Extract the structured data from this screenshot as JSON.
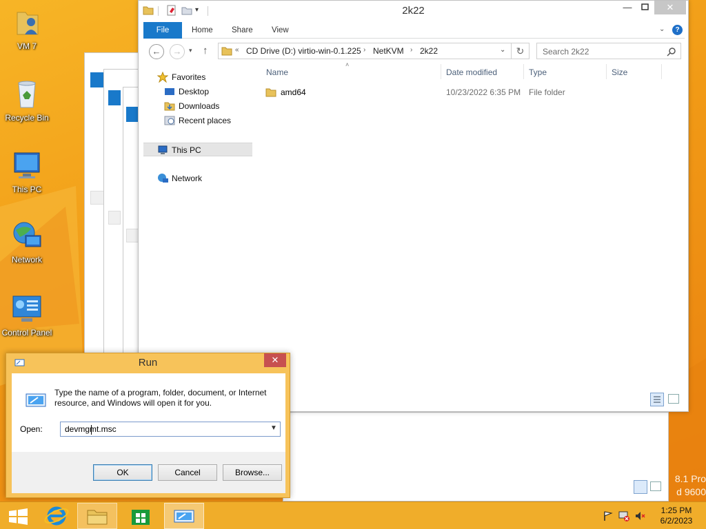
{
  "desktop": {
    "icons": [
      {
        "label": "VM 7",
        "icon": "user-folder-icon"
      },
      {
        "label": "Recycle Bin",
        "icon": "recycle-bin-icon"
      },
      {
        "label": "This PC",
        "icon": "computer-icon"
      },
      {
        "label": "Network",
        "icon": "network-icon"
      },
      {
        "label": "Control Panel",
        "icon": "control-panel-icon"
      }
    ],
    "watermark_line1": "8.1 Pro",
    "watermark_line2": "d 9600"
  },
  "explorer": {
    "title": "2k22",
    "ribbon_tabs": [
      "File",
      "Home",
      "Share",
      "View"
    ],
    "address": {
      "overflow": "«",
      "crumbs": [
        "CD Drive (D:) virtio-win-0.1.225",
        "NetKVM",
        "2k22"
      ]
    },
    "search_placeholder": "Search 2k22",
    "nav_pane": {
      "favorites": "Favorites",
      "desktop": "Desktop",
      "downloads": "Downloads",
      "recent": "Recent places",
      "this_pc": "This PC",
      "network": "Network"
    },
    "columns": {
      "name": "Name",
      "date": "Date modified",
      "type": "Type",
      "size": "Size"
    },
    "files": [
      {
        "name": "amd64",
        "date": "10/23/2022 6:35 PM",
        "type": "File folder",
        "size": ""
      }
    ]
  },
  "run_dialog": {
    "title": "Run",
    "description": "Type the name of a program, folder, document, or Internet resource, and Windows will open it for you.",
    "open_label": "Open:",
    "open_value": "devmgmt.msc",
    "ok": "OK",
    "cancel": "Cancel",
    "browse": "Browse..."
  },
  "taskbar": {
    "clock_time": "1:25 PM",
    "clock_date": "6/2/2023"
  },
  "colors": {
    "accent": "#1979ca",
    "desktop": "#f2a11a",
    "taskbar": "#f0ad2a",
    "run_frame": "#f7c35a",
    "close_red": "#c75050"
  }
}
